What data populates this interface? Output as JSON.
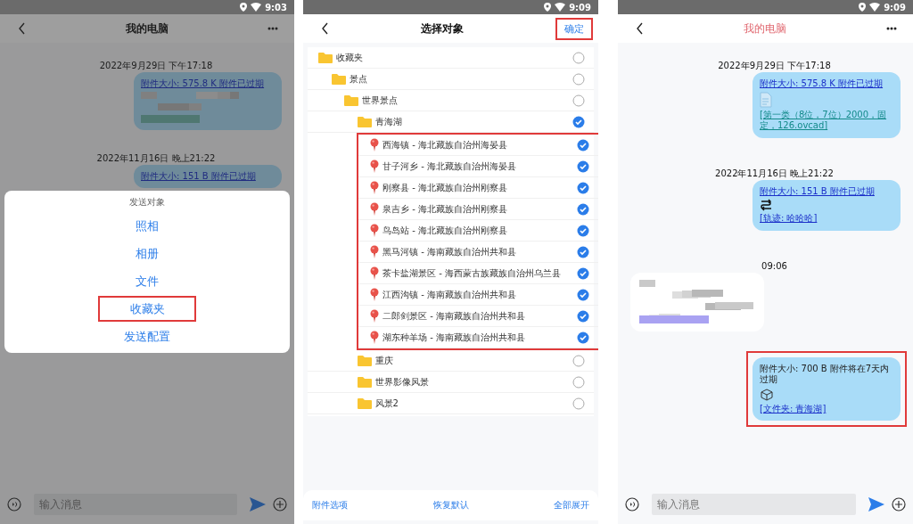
{
  "panels": [
    {
      "kind": "chat",
      "dimmed": true,
      "status_bar": {
        "time": "9:03"
      },
      "header": {
        "title": "我的电脑",
        "accent": false
      },
      "messages": [
        {
          "kind": "date",
          "text": "2022年9月29日 下午17:18"
        },
        {
          "kind": "sent",
          "header": "附件大小: 575.8 K 附件已过期",
          "header_link": true,
          "redacted": true,
          "highlighted": false
        },
        {
          "kind": "date",
          "text": "2022年11月16日 晚上21:22"
        },
        {
          "kind": "sent",
          "header": "附件大小: 151 B 附件已过期",
          "header_link": true,
          "highlighted": false
        }
      ],
      "composer": {
        "placeholder": "输入消息"
      },
      "sheet": {
        "title": "发送对象",
        "options": [
          {
            "label": "照相",
            "highlighted": false
          },
          {
            "label": "相册",
            "highlighted": false
          },
          {
            "label": "文件",
            "highlighted": false
          },
          {
            "label": "收藏夹",
            "highlighted": true
          },
          {
            "label": "发送配置",
            "highlighted": false
          }
        ]
      }
    },
    {
      "kind": "picker",
      "status_bar": {
        "time": "9:09"
      },
      "header": {
        "title": "选择对象",
        "action": "确定",
        "action_highlighted": true
      },
      "tree": [
        {
          "label": "收藏夹",
          "kind": "folder",
          "checked": false,
          "children": [
            {
              "label": "景点",
              "kind": "folder",
              "checked": false,
              "children": [
                {
                  "label": "世界景点",
                  "kind": "folder",
                  "checked": false,
                  "children": [
                    {
                      "label": "青海湖",
                      "kind": "folder",
                      "checked": true,
                      "children_highlighted": true,
                      "children": [
                        {
                          "label": "西海镇 - 海北藏族自治州海晏县",
                          "kind": "place",
                          "checked": true
                        },
                        {
                          "label": "甘子河乡 - 海北藏族自治州海晏县",
                          "kind": "place",
                          "checked": true
                        },
                        {
                          "label": "刚察县 - 海北藏族自治州刚察县",
                          "kind": "place",
                          "checked": true
                        },
                        {
                          "label": "泉吉乡 - 海北藏族自治州刚察县",
                          "kind": "place",
                          "checked": true
                        },
                        {
                          "label": "鸟岛站 - 海北藏族自治州刚察县",
                          "kind": "place",
                          "checked": true
                        },
                        {
                          "label": "黑马河镇 - 海南藏族自治州共和县",
                          "kind": "place",
                          "checked": true
                        },
                        {
                          "label": "茶卡盐湖景区 - 海西蒙古族藏族自治州乌兰县",
                          "kind": "place",
                          "checked": true
                        },
                        {
                          "label": "江西沟镇 - 海南藏族自治州共和县",
                          "kind": "place",
                          "checked": true
                        },
                        {
                          "label": "二郎剑景区 - 海南藏族自治州共和县",
                          "kind": "place",
                          "checked": true
                        },
                        {
                          "label": "湖东种羊场 - 海南藏族自治州共和县",
                          "kind": "place",
                          "checked": true
                        }
                      ]
                    },
                    {
                      "label": "重庆",
                      "kind": "folder",
                      "checked": false
                    },
                    {
                      "label": "世界影像风景",
                      "kind": "folder",
                      "checked": false
                    },
                    {
                      "label": "风景2",
                      "kind": "folder",
                      "checked": false
                    }
                  ]
                }
              ]
            }
          ]
        }
      ],
      "footer": [
        "附件选项",
        "恢复默认",
        "全部展开"
      ]
    },
    {
      "kind": "chat",
      "dimmed": false,
      "status_bar": {
        "time": "9:09"
      },
      "header": {
        "title": "我的电脑",
        "accent": true
      },
      "messages": [
        {
          "kind": "date",
          "text": "2022年9月29日 下午17:18"
        },
        {
          "kind": "sent",
          "header": "附件大小: 575.8 K 附件已过期",
          "header_link": true,
          "attachment": {
            "kind": "file",
            "caption": "[第一类（8位，7位）2000，固定，126.ovcad]"
          },
          "highlighted": false
        },
        {
          "kind": "date",
          "text": "2022年11月16日 晚上21:22"
        },
        {
          "kind": "sent",
          "header": "附件大小: 151 B 附件已过期",
          "header_link": true,
          "attachment": {
            "kind": "track",
            "caption": "[轨迹: 哈哈哈]"
          },
          "highlighted": false
        },
        {
          "kind": "date",
          "text": "09:06"
        },
        {
          "kind": "received",
          "redacted": true,
          "highlighted": false
        },
        {
          "kind": "sent",
          "header": "附件大小: 700 B 附件将在7天内过期",
          "header_link": false,
          "attachment": {
            "kind": "folder",
            "caption": "[文件夹: 青海湖]"
          },
          "highlighted": true
        }
      ],
      "composer": {
        "placeholder": "输入消息"
      }
    }
  ]
}
